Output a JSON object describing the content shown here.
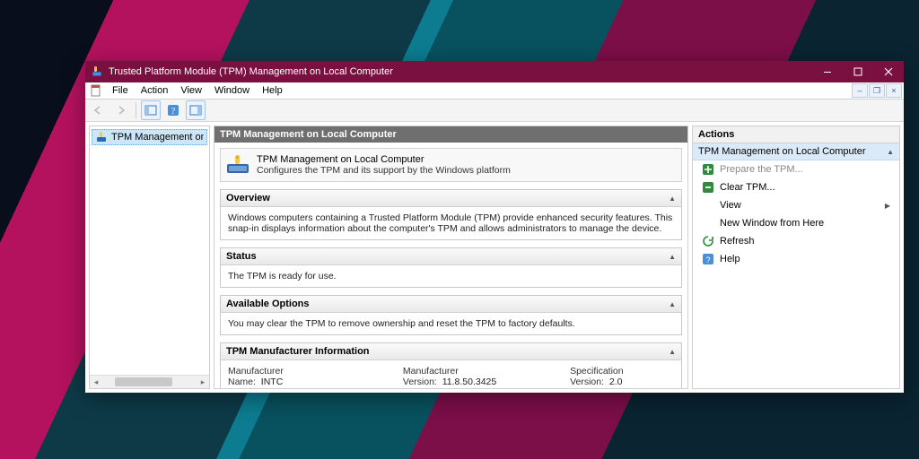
{
  "window": {
    "title": "Trusted Platform Module (TPM) Management on Local Computer"
  },
  "menu": {
    "file": "File",
    "action": "Action",
    "view": "View",
    "window": "Window",
    "help": "Help"
  },
  "tree": {
    "root": "TPM Management on Local Comp"
  },
  "main": {
    "header": "TPM Management on Local Computer",
    "intro_title": "TPM Management on Local Computer",
    "intro_sub": "Configures the TPM and its support by the Windows platform",
    "overview": {
      "title": "Overview",
      "text": "Windows computers containing a Trusted Platform Module (TPM) provide enhanced security features. This snap-in displays information about the computer's TPM and allows administrators to manage the device."
    },
    "status": {
      "title": "Status",
      "text": "The TPM is ready for use."
    },
    "options": {
      "title": "Available Options",
      "text": "You may clear the TPM to remove ownership and reset the TPM to factory defaults."
    },
    "mfr": {
      "title": "TPM Manufacturer Information",
      "name_label": "Manufacturer Name:",
      "name_value": "INTC",
      "ver_label": "Manufacturer Version:",
      "ver_value": "11.8.50.3425",
      "spec_label": "Specification Version:",
      "spec_value": "2.0"
    }
  },
  "actions": {
    "header": "Actions",
    "group": "TPM Management on Local Computer",
    "prepare": "Prepare the TPM...",
    "clear": "Clear TPM...",
    "view": "View",
    "new_window": "New Window from Here",
    "refresh": "Refresh",
    "help": "Help"
  }
}
